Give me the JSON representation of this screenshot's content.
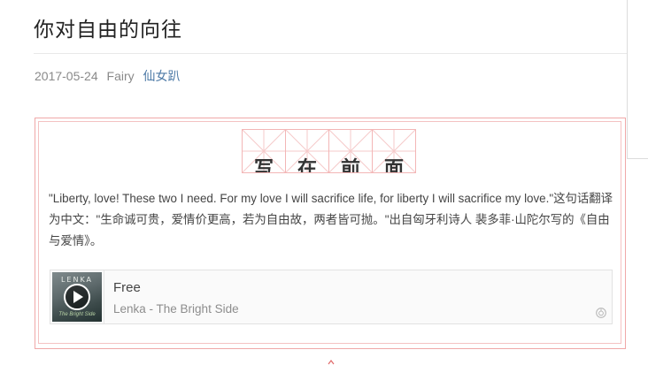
{
  "article": {
    "title": "你对自由的向往",
    "date": "2017-05-24",
    "author": "Fairy",
    "author_alias": "仙女趴"
  },
  "section_heading": {
    "chars": [
      "写",
      "在",
      "前",
      "面"
    ]
  },
  "body": {
    "paragraph": "\"Liberty, love! These two I need. For my love I will sacrifice life, for liberty I will sacrifice my love.\"这句话翻译为中文：\"生命诚可贵，爱情价更高，若为自由故，两者皆可抛。\"出自匈牙利诗人 裴多菲·山陀尔写的《自由与爱情》。"
  },
  "player": {
    "song_title": "Free",
    "artist_album": "Lenka - The Bright Side",
    "cover_text": "LENKA",
    "cover_subtext": "The Bright Side"
  },
  "colors": {
    "grid_border": "#f3b6b6",
    "box_border": "#f0a8a8",
    "author_link": "#4c79a6"
  }
}
